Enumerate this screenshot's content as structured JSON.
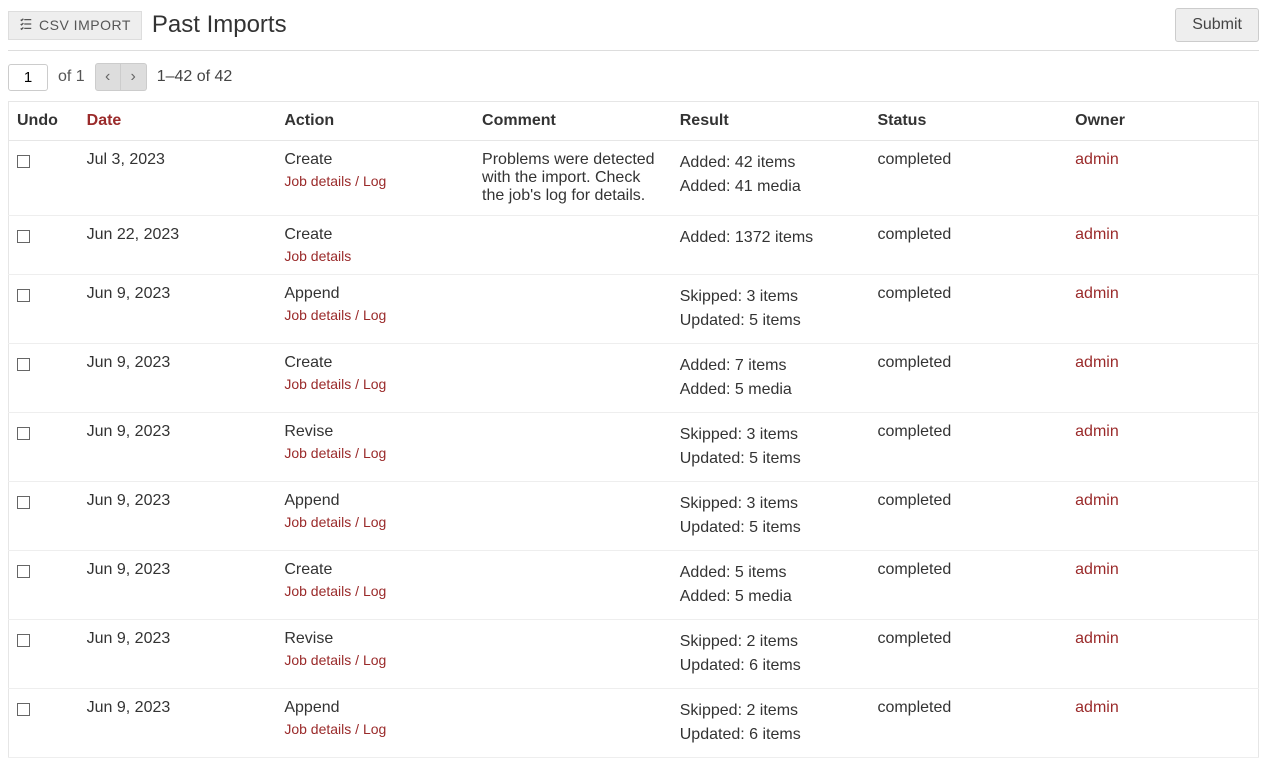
{
  "header": {
    "csv_import_label": "CSV IMPORT",
    "page_title": "Past Imports",
    "submit_label": "Submit"
  },
  "pager": {
    "current_page": "1",
    "of_label": "of 1",
    "range_label": "1–42 of 42"
  },
  "columns": {
    "undo": "Undo",
    "date": "Date",
    "action": "Action",
    "comment": "Comment",
    "result": "Result",
    "status": "Status",
    "owner": "Owner"
  },
  "links": {
    "job_details": "Job details",
    "log": "Log"
  },
  "rows": [
    {
      "date": "Jul 3, 2023",
      "action": "Create",
      "has_log": true,
      "comment": "Problems were detected with the import. Check the job's log for details.",
      "result": [
        "Added: 42 items",
        "Added: 41 media"
      ],
      "status": "completed",
      "owner": "admin"
    },
    {
      "date": "Jun 22, 2023",
      "action": "Create",
      "has_log": false,
      "comment": "",
      "result": [
        "Added: 1372 items"
      ],
      "status": "completed",
      "owner": "admin"
    },
    {
      "date": "Jun 9, 2023",
      "action": "Append",
      "has_log": true,
      "comment": "",
      "result": [
        "Skipped: 3 items",
        "Updated: 5 items"
      ],
      "status": "completed",
      "owner": "admin"
    },
    {
      "date": "Jun 9, 2023",
      "action": "Create",
      "has_log": true,
      "comment": "",
      "result": [
        "Added: 7 items",
        "Added: 5 media"
      ],
      "status": "completed",
      "owner": "admin"
    },
    {
      "date": "Jun 9, 2023",
      "action": "Revise",
      "has_log": true,
      "comment": "",
      "result": [
        "Skipped: 3 items",
        "Updated: 5 items"
      ],
      "status": "completed",
      "owner": "admin"
    },
    {
      "date": "Jun 9, 2023",
      "action": "Append",
      "has_log": true,
      "comment": "",
      "result": [
        "Skipped: 3 items",
        "Updated: 5 items"
      ],
      "status": "completed",
      "owner": "admin"
    },
    {
      "date": "Jun 9, 2023",
      "action": "Create",
      "has_log": true,
      "comment": "",
      "result": [
        "Added: 5 items",
        "Added: 5 media"
      ],
      "status": "completed",
      "owner": "admin"
    },
    {
      "date": "Jun 9, 2023",
      "action": "Revise",
      "has_log": true,
      "comment": "",
      "result": [
        "Skipped: 2 items",
        "Updated: 6 items"
      ],
      "status": "completed",
      "owner": "admin"
    },
    {
      "date": "Jun 9, 2023",
      "action": "Append",
      "has_log": true,
      "comment": "",
      "result": [
        "Skipped: 2 items",
        "Updated: 6 items"
      ],
      "status": "completed",
      "owner": "admin"
    }
  ]
}
